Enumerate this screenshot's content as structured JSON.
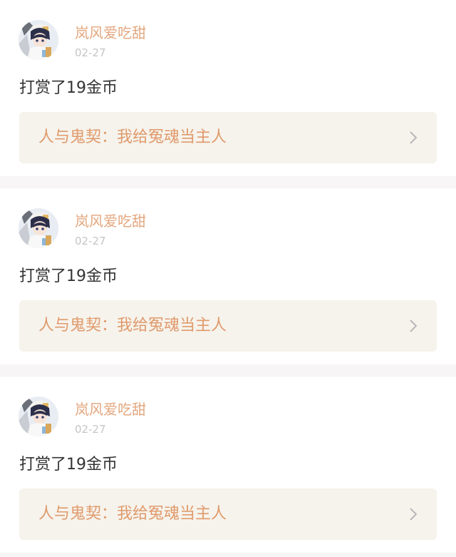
{
  "colors": {
    "username": "#e3a77f",
    "book_title": "#e09a6c",
    "book_link_bg": "#f6f3ec",
    "date": "#c5c5c5",
    "separator_bg": "#f7f5f5"
  },
  "items": [
    {
      "username": "岚风爱吃甜",
      "date": "02-27",
      "message": "打赏了19金币",
      "book_title": "人与鬼契：我给冤魂当主人",
      "avatar_icon": "user-avatar-icon",
      "chevron_icon": "chevron-right-icon"
    },
    {
      "username": "岚风爱吃甜",
      "date": "02-27",
      "message": "打赏了19金币",
      "book_title": "人与鬼契：我给冤魂当主人",
      "avatar_icon": "user-avatar-icon",
      "chevron_icon": "chevron-right-icon"
    },
    {
      "username": "岚风爱吃甜",
      "date": "02-27",
      "message": "打赏了19金币",
      "book_title": "人与鬼契：我给冤魂当主人",
      "avatar_icon": "user-avatar-icon",
      "chevron_icon": "chevron-right-icon"
    }
  ]
}
